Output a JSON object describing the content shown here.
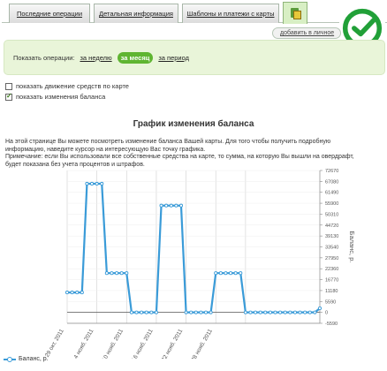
{
  "tabs": [
    {
      "label": "Последние операции"
    },
    {
      "label": "Детальная информация"
    },
    {
      "label": "Шаблоны и платежи с карты"
    }
  ],
  "favorites": {
    "label": "добавить в личное"
  },
  "period": {
    "label": "Показать операции:",
    "options": [
      "за неделю",
      "за месяц",
      "за период"
    ],
    "active": "за месяц"
  },
  "options": {
    "movement_label": "показать движение средств по карте",
    "movement_checked": false,
    "balance_label": "показать изменения баланса",
    "balance_checked": true
  },
  "chart_title": "График изменения баланса",
  "description": {
    "line1": "На этой странице Вы можете посмотреть изменение баланса Вашей карты. Для того чтобы получить подробную",
    "line2": "информацию, наведите курсор на интересующую Вас точку графика.",
    "line3": "Примечание: если Вы использовали все собственные средства на карте, то сумма, на которую Вы вышли на овердрафт,",
    "line4": "будет показана без учета процентов и штрафов."
  },
  "colors": {
    "line": "#3a9bd8",
    "accent": "#5fb531",
    "grid": "#d6d6d6"
  },
  "chart_data": {
    "type": "line",
    "title": "",
    "xlabel": "",
    "ylabel": "Баланс, р.",
    "ylim": [
      -5590,
      72670
    ],
    "yticks": [
      -5590,
      0,
      5590,
      11180,
      16770,
      22360,
      27950,
      33540,
      39130,
      44720,
      50310,
      55900,
      61490,
      67080,
      72670
    ],
    "xticks": [
      "29 окт. 2011",
      "4 нояб. 2011",
      "10 нояб. 2011",
      "16 нояб. 2011",
      "22 нояб. 2011",
      "28 нояб. 2011"
    ],
    "grid": true,
    "legend": "bottom-left",
    "series": [
      {
        "name": "Баланс, р.",
        "values": [
          10200,
          10200,
          10200,
          10200,
          65900,
          65900,
          65900,
          65900,
          20100,
          20100,
          20100,
          20100,
          20100,
          0,
          0,
          0,
          0,
          0,
          0,
          54700,
          54700,
          54700,
          54700,
          54700,
          0,
          0,
          0,
          0,
          0,
          0,
          20100,
          20100,
          20100,
          20100,
          20100,
          20100,
          0,
          0,
          0,
          0,
          0,
          0,
          0,
          0,
          0,
          0,
          0,
          0,
          0,
          0,
          0,
          2100
        ]
      }
    ]
  }
}
